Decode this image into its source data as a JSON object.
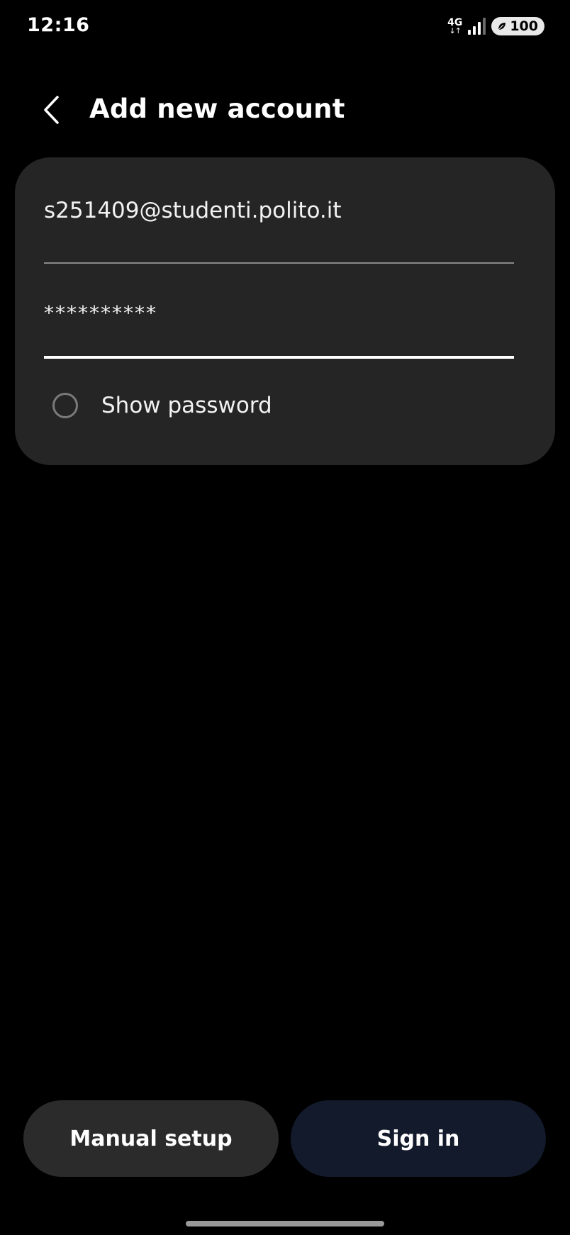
{
  "status_bar": {
    "time": "12:16",
    "network": "4G",
    "network_arrows": "↓↑",
    "battery": "100"
  },
  "header": {
    "title": "Add new account"
  },
  "form": {
    "email_value": "s251409@studenti.polito.it",
    "password_value": "**********",
    "show_password_label": "Show password",
    "show_password_checked": false
  },
  "actions": {
    "manual_setup_label": "Manual setup",
    "sign_in_label": "Sign in"
  },
  "colors": {
    "background": "#000000",
    "card": "#252525",
    "manual_button": "#2b2b2b",
    "sign_in_button": "#121a2b",
    "text": "#ffffff"
  },
  "icons": {
    "back": "chevron-left-icon",
    "signal": "signal-bars-icon",
    "battery_saver": "leaf-icon"
  }
}
